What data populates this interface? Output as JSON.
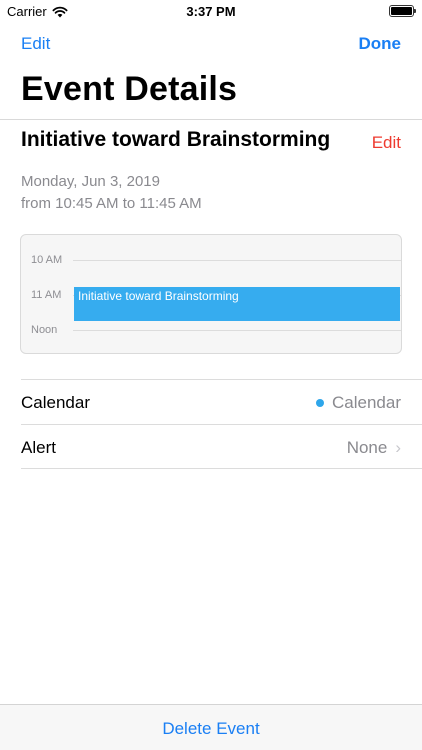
{
  "status_bar": {
    "carrier": "Carrier",
    "time": "3:37 PM",
    "battery_level": 1.0
  },
  "nav": {
    "left_label": "Edit",
    "right_label": "Done",
    "title": "Event Details"
  },
  "event": {
    "title": "Initiative toward Brainstorming",
    "edit_label": "Edit",
    "date": "Monday, Jun 3, 2019",
    "time_range": "from 10:45 AM to 11:45 AM"
  },
  "day_preview": {
    "hours": [
      "10 AM",
      "11 AM",
      "Noon"
    ],
    "event_label": "Initiative toward Brainstorming",
    "event_color": "#36acef"
  },
  "details": {
    "calendar": {
      "label": "Calendar",
      "value": "Calendar",
      "dot_color": "#2ea6ea"
    },
    "alert": {
      "label": "Alert",
      "value": "None"
    }
  },
  "bottom": {
    "delete_label": "Delete Event"
  },
  "colors": {
    "accent": "#1a7ff4",
    "destructive": "#ee3a2f",
    "secondary_text": "#8a8a8f"
  }
}
